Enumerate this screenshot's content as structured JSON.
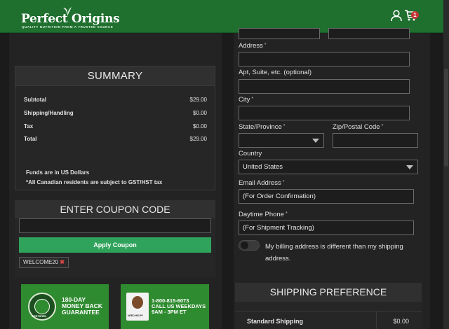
{
  "header": {
    "brand": "Perfect Origins",
    "tagline": "QUALITY NUTRITION FROM A TRUSTED SOURCE",
    "cart_count": "1",
    "bg_color": "#1f6f2e"
  },
  "summary": {
    "title": "SUMMARY",
    "rows": [
      {
        "label": "Subtotal",
        "value": "$29.00"
      },
      {
        "label": "Shipping/Handling",
        "value": "$0.00"
      },
      {
        "label": "Tax",
        "value": "$0.00"
      },
      {
        "label": "Total",
        "value": "$29.00"
      }
    ],
    "note1": "Funds are in US Dollars",
    "note2": "*All Canadian residents are subject to GST/HST tax"
  },
  "coupon": {
    "title": "ENTER COUPON CODE",
    "input_value": "",
    "apply_label": "Apply Coupon",
    "applied_code": "WELCOME20",
    "remove_glyph": "✖",
    "button_color": "#2fa35b"
  },
  "badges": {
    "guarantee_lines": [
      "180-DAY",
      "MONEY BACK",
      "GUARANTEE"
    ],
    "seal_label": "CERTIFIED",
    "phone_lines": [
      "1-800-815-6073",
      "CALL US WEEKDAYS",
      "9AM - 3PM ET"
    ],
    "phone_caption": "NEED HELP?"
  },
  "form": {
    "address_label": "Address",
    "address_value": "",
    "apt_label": "Apt, Suite, etc. (optional)",
    "apt_value": "",
    "city_label": "City",
    "city_value": "",
    "state_label": "State/Province",
    "state_value": "",
    "zip_label": "Zip/Postal Code",
    "zip_value": "",
    "country_label": "Country",
    "country_value": "United States",
    "email_label": "Email Address",
    "email_placeholder": "(For Order Confirmation)",
    "phone_label": "Daytime Phone",
    "phone_placeholder": "(For Shipment Tracking)",
    "required_mark": "*",
    "billing_toggle_label": "My billing address is different than my shipping address."
  },
  "shipping": {
    "title": "SHIPPING PREFERENCE",
    "option_name": "Standard Shipping",
    "option_price": "$0.00"
  }
}
